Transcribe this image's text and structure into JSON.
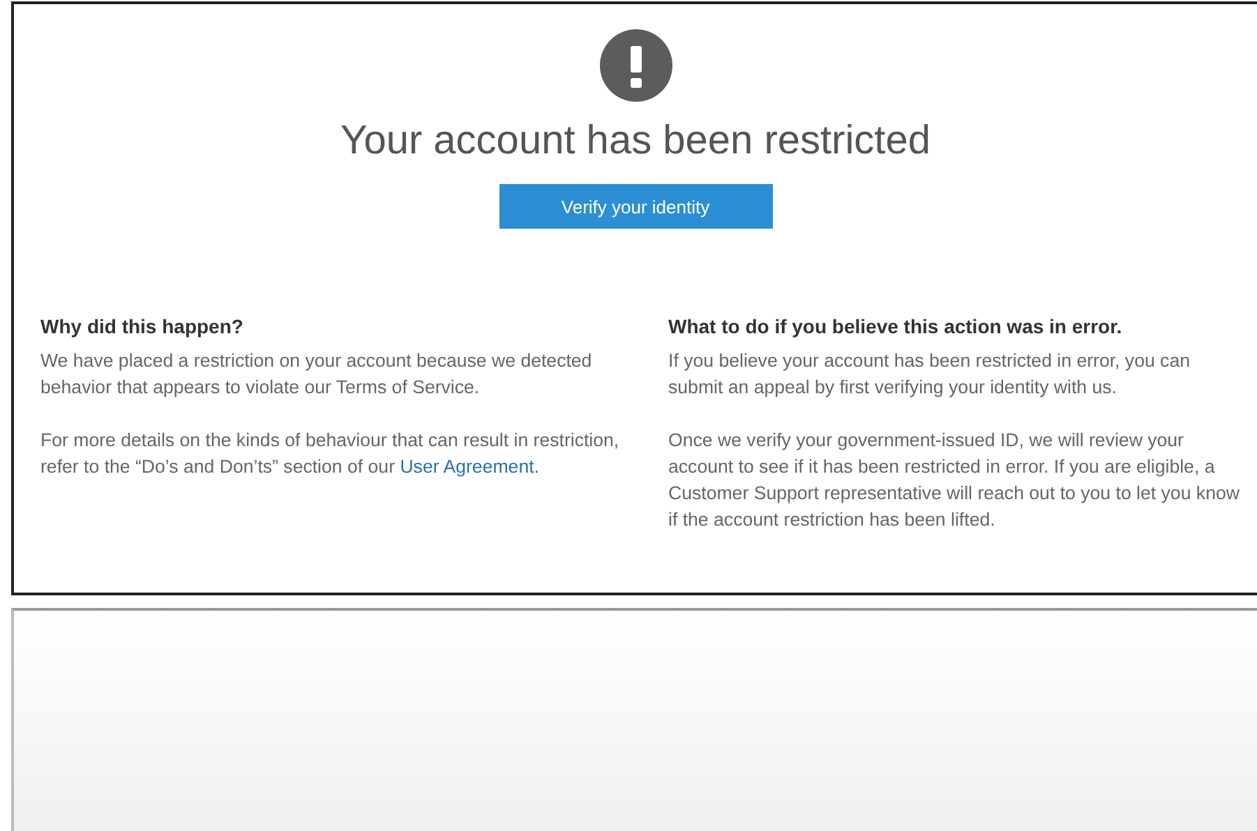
{
  "title": "Your account has been restricted",
  "button": "Verify your identity",
  "sections": [
    {
      "heading": "Why did this happen?",
      "paragraphs": [
        "We have placed a restriction on your account because we detected behavior that appears to violate our Terms of Service.",
        "For more details on the kinds of behaviour that can result in restriction, refer to the “Do’s and Don’ts” section of our"
      ],
      "link": "User Agreement",
      "after_link": "."
    },
    {
      "heading": "What to do if you believe this action was in error.",
      "paragraphs": [
        "If you believe your account has been restricted in error, you can submit an appeal by first verifying your identity with us.",
        "Once we verify your government-issued ID, we will review your account to see if it has been restricted in error. If you are eligible, a Customer Support representative will reach out to you to let you know if the account restriction has been lifted."
      ]
    }
  ]
}
